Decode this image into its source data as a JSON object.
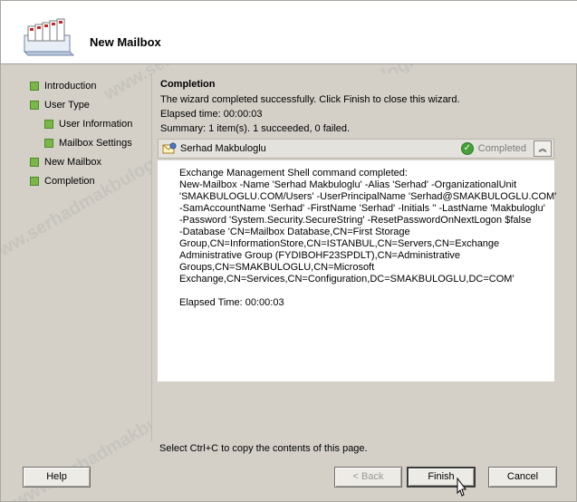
{
  "window": {
    "title": "New Mailbox"
  },
  "nav": {
    "items": [
      {
        "label": "Introduction",
        "level": 0
      },
      {
        "label": "User Type",
        "level": 0
      },
      {
        "label": "User Information",
        "level": 1
      },
      {
        "label": "Mailbox Settings",
        "level": 1
      },
      {
        "label": "New Mailbox",
        "level": 0
      },
      {
        "label": "Completion",
        "level": 0
      }
    ]
  },
  "main": {
    "heading": "Completion",
    "message": "The wizard completed successfully. Click Finish to close this wizard.",
    "elapsed": "Elapsed time: 00:00:03",
    "summary": "Summary: 1 item(s). 1 succeeded, 0 failed."
  },
  "result": {
    "name": "Serhad Makbuloglu",
    "status": "Completed",
    "lines": [
      "Exchange Management Shell command completed:",
      "New-Mailbox -Name 'Serhad Makbuloglu' -Alias 'Serhad' -OrganizationalUnit",
      "'SMAKBULOGLU.COM/Users' -UserPrincipalName 'Serhad@SMAKBULOGLU.COM'",
      "-SamAccountName 'Serhad' -FirstName 'Serhad' -Initials '' -LastName 'Makbuloglu'",
      "-Password 'System.Security.SecureString' -ResetPasswordOnNextLogon $false",
      "-Database 'CN=Mailbox Database,CN=First Storage",
      "Group,CN=InformationStore,CN=ISTANBUL,CN=Servers,CN=Exchange",
      "Administrative Group (FYDIBOHF23SPDLT),CN=Administrative",
      "Groups,CN=SMAKBULOGLU,CN=Microsoft",
      "Exchange,CN=Services,CN=Configuration,DC=SMAKBULOGLU,DC=COM'",
      "",
      "Elapsed Time: 00:00:03"
    ]
  },
  "footer": {
    "hint": "Select Ctrl+C to copy the contents of this page.",
    "help": "Help",
    "back": "< Back",
    "finish": "Finish",
    "cancel": "Cancel"
  },
  "watermark": "www.serhadmakbuloglu.com.tr",
  "colors": {
    "nav_bullet": "#7ab648",
    "status_ok": "#47a13a",
    "background": "#d4d0c8"
  },
  "icons": {
    "header": "mailbox-stack-icon",
    "result": "user-mailbox-icon",
    "status": "check-circle-icon",
    "collapse": "double-chevron-up-icon"
  }
}
